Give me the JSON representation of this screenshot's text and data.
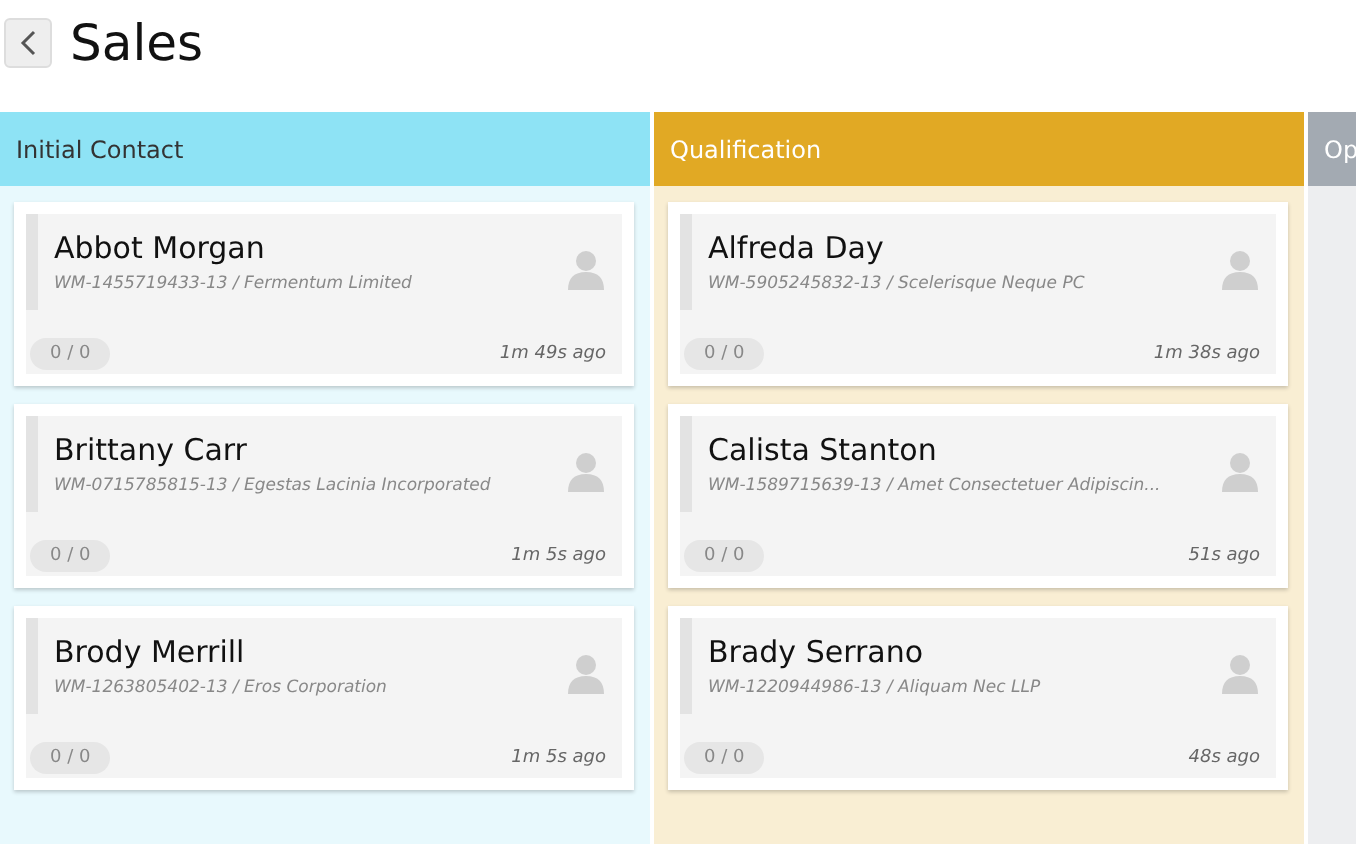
{
  "page": {
    "title": "Sales"
  },
  "columns": [
    {
      "title": "Initial Contact",
      "color": "#8ee3f5",
      "cards": [
        {
          "name": "Abbot Morgan",
          "subtitle": "WM-1455719433-13 / Fermentum Limited",
          "count": "0 / 0",
          "time": "1m 49s ago"
        },
        {
          "name": "Brittany Carr",
          "subtitle": "WM-0715785815-13 / Egestas Lacinia Incorporated",
          "count": "0 / 0",
          "time": "1m 5s ago"
        },
        {
          "name": "Brody Merrill",
          "subtitle": "WM-1263805402-13 / Eros Corporation",
          "count": "0 / 0",
          "time": "1m 5s ago"
        }
      ]
    },
    {
      "title": "Qualification",
      "color": "#e1a924",
      "cards": [
        {
          "name": "Alfreda Day",
          "subtitle": "WM-5905245832-13 / Scelerisque Neque PC",
          "count": "0 / 0",
          "time": "1m 38s ago"
        },
        {
          "name": "Calista Stanton",
          "subtitle": "WM-1589715639-13 / Amet Consectetuer Adipiscin...",
          "count": "0 / 0",
          "time": "51s ago"
        },
        {
          "name": "Brady Serrano",
          "subtitle": "WM-1220944986-13 / Aliquam Nec LLP",
          "count": "0 / 0",
          "time": "48s ago"
        }
      ]
    },
    {
      "title": "Op",
      "color": "#a3aab2"
    }
  ]
}
